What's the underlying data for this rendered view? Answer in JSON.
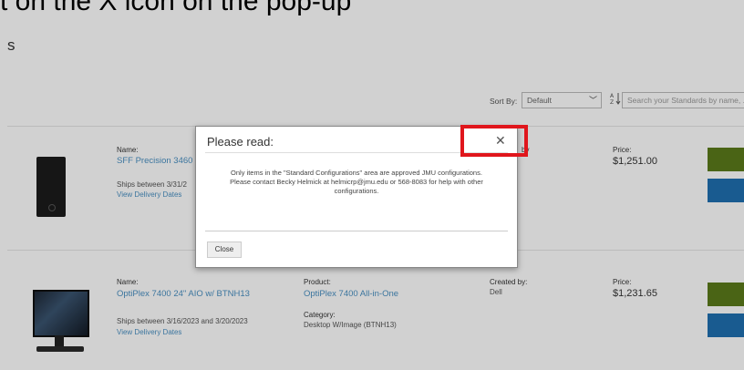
{
  "caption": "t on the X icon on the pop-up",
  "page": {
    "heading": "s"
  },
  "toolbar": {
    "sort_label": "Sort By:",
    "sort_value": "Default",
    "sort_icon": "chevron-down-icon",
    "az_icon": "sort-az-icon",
    "search_placeholder": "Search your Standards by name, ..."
  },
  "products": [
    {
      "name_label": "Name:",
      "name": "SFF Precision 3460",
      "ships": "Ships between 3/31/2",
      "delivery_link": "View Delivery Dates",
      "created_label": "by",
      "price_label": "Price:",
      "price": "$1,251.00"
    },
    {
      "name_label": "Name:",
      "name": "OptiPlex 7400 24\" AIO w/ BTNH13",
      "product_label": "Product:",
      "product": "OptiPlex 7400 All-in-One",
      "category_label": "Category:",
      "category": "Desktop W/Image (BTNH13)",
      "created_label": "Created by:",
      "created_by": "Dell",
      "ships": "Ships between 3/16/2023 and 3/20/2023",
      "delivery_link": "View Delivery Dates",
      "price_label": "Price:",
      "price": "$1,231.65"
    }
  ],
  "modal": {
    "title": "Please read:",
    "body_line1": "Only items in the \"Standard Configurations\" area are approved JMU configurations.",
    "body_line2": "Please contact Becky Helmick at helmicrp@jmu.edu or 568-8083 for help with other",
    "body_line3": "configurations.",
    "close_button": "Close",
    "close_icon_glyph": "✕"
  },
  "colors": {
    "highlight": "#e0161c",
    "link": "#4a90c2",
    "add_button": "#5b7a1a",
    "info_button": "#1f6fb0"
  }
}
